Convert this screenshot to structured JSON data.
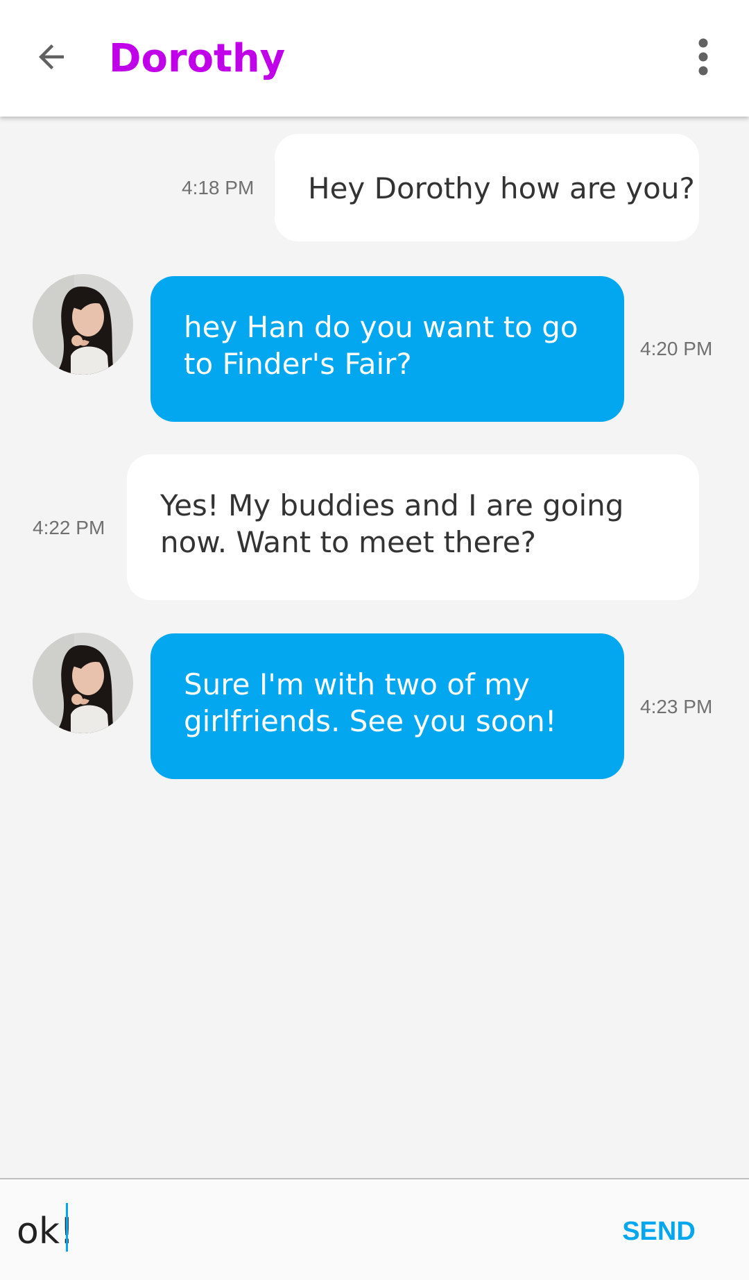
{
  "header": {
    "title": "Dorothy",
    "back_icon": "arrow-back-icon",
    "menu_icon": "more-vert-icon",
    "title_color": "#c000e8"
  },
  "messages": [
    {
      "side": "out",
      "text": "Hey Dorothy how are you?",
      "time": "4:18 PM"
    },
    {
      "side": "in",
      "text": "hey Han do you want to go to Finder's Fair?",
      "time": "4:20 PM"
    },
    {
      "side": "out",
      "text": "Yes! My buddies and I are going now. Want to meet there?",
      "time": "4:22 PM"
    },
    {
      "side": "in",
      "text": "Sure I'm with two of my girlfriends. See you soon!",
      "time": "4:23 PM"
    }
  ],
  "composer": {
    "value": "ok!",
    "send_label": "SEND"
  },
  "colors": {
    "accent": "#02a7ef",
    "incoming_bubble": "#02a7ef",
    "outgoing_bubble": "#ffffff",
    "background": "#f4f4f4"
  }
}
